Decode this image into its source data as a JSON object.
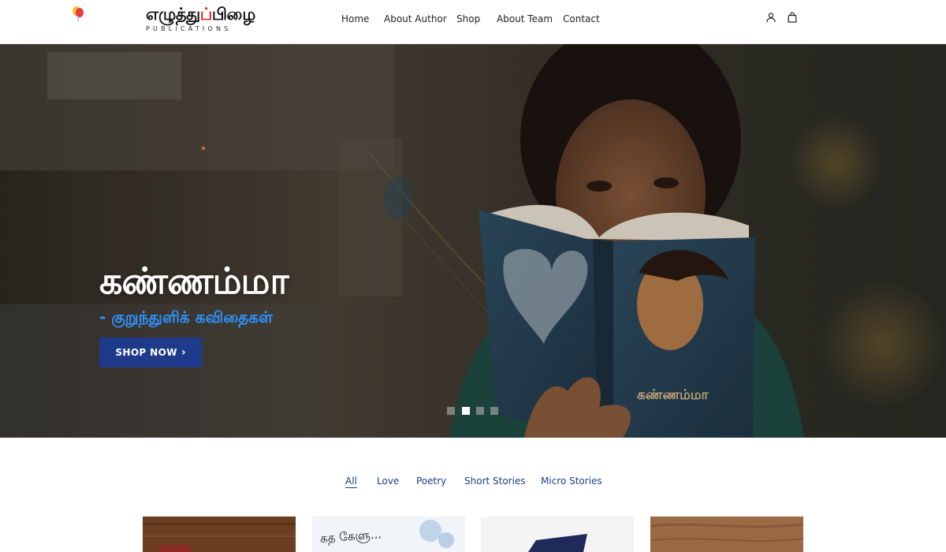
{
  "header": {
    "logo_tamil_main": "எழுத்து",
    "logo_tamil_accent": "ப்",
    "logo_tamil_end": "பிழை",
    "logo_sub": "PUBLICATIONS",
    "nav": [
      {
        "label": "Home"
      },
      {
        "label": "About Author"
      },
      {
        "label": "Shop"
      },
      {
        "label": "About Team"
      },
      {
        "label": "Contact"
      }
    ],
    "icons": [
      "balloons-icon",
      "user-icon",
      "shopping-bag-icon"
    ]
  },
  "hero": {
    "title": "கண்ணம்மா",
    "subtitle": "- குறுந்துளிக் கவிதைகள்",
    "button_label": "SHOP NOW",
    "button_icon": "chevron-right-icon",
    "slides_count": 4,
    "active_slide": 2,
    "colors": {
      "subtitle": "#2f93ff",
      "button": "#1e3a8a"
    }
  },
  "categories": {
    "items": [
      {
        "label": "All",
        "active": true
      },
      {
        "label": "Love"
      },
      {
        "label": "Poetry"
      },
      {
        "label": "Short Stories"
      },
      {
        "label": "Micro Stories"
      }
    ],
    "color": "#1e3a8a"
  },
  "products": {
    "card2_text": "கத கேளு..."
  }
}
